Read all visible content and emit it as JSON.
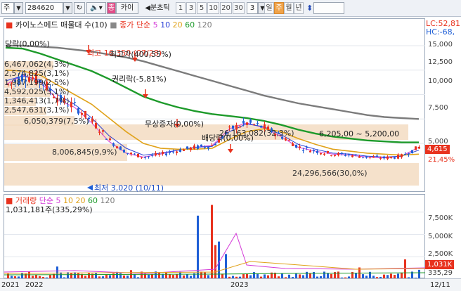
{
  "toolbar": {
    "market": "주",
    "code": "284620",
    "corner_btn": "↻",
    "kind": "종",
    "name": "카이",
    "period_prefix": "◀분초틱",
    "periods": [
      "1",
      "3",
      "5",
      "10",
      "20",
      "30"
    ],
    "count": "3",
    "day": "일",
    "week": "주",
    "month": "월",
    "year": "년"
  },
  "legend": {
    "title": "카이노스메드 매물대 수(10)",
    "ma_label": "종가 단순",
    "ma": [
      "5",
      "10",
      "20",
      "60",
      "120"
    ]
  },
  "volume_legend": {
    "title": "거래량",
    "ma_label": "단순",
    "ma": [
      "5",
      "10",
      "20",
      "60",
      "120"
    ],
    "summary": "1,031,181주(335,29%)"
  },
  "annotations": {
    "top_left": "당락(0,00%)",
    "high": "최고 16,350 (07/28)",
    "high_rate": "최고가(400,55%)",
    "right_issue": "권리락(-5,81%)",
    "split": "무상증자(0,00%)",
    "dividend": "배당락(0,00%)",
    "low": "최저 3,020 (10/11)",
    "range": "6,205,00 ~ 5,200,00"
  },
  "volume_profile": [
    "6,467,062(4,3%)",
    "2,574,825(3,1%)",
    "1,987,199(2,5%)",
    "4,592,025(5,1%)",
    "1,346,413(1,7%)",
    "2,547,631(3,1%)",
    "6,050,379(7,5%)",
    "8,006,845(9,9%)",
    "26,163,082(32,3%)",
    "24,296,566(30,0%)"
  ],
  "right_axis": {
    "lc": "LC:52,81",
    "hc": "HC:-68,",
    "price_ticks": [
      "15,000",
      "12,500",
      "10,000",
      "7,500",
      "5,000"
    ],
    "current_price": "4,615",
    "current_rate": "21,45%",
    "volume_ticks": [
      "7,500K",
      "5,000K",
      "2,500K"
    ],
    "current_volume": "1,031K",
    "current_volume_rate": "335,29"
  },
  "dates": {
    "left_cut": "2021",
    "y2022": "2022",
    "y2023": "2023",
    "right": "12/11"
  },
  "colors": {
    "up": "#e8321e",
    "down": "#1f5fd6",
    "ma5": "#d43bd8",
    "ma10": "#2a3fd6",
    "ma20": "#e0a21a",
    "ma60": "#1d9a2a",
    "ma120": "#7b7b7b",
    "profile": "#f3dcc2"
  },
  "chart_data": {
    "type": "candlestick",
    "ylim": [
      3000,
      16350
    ],
    "x_labels": [
      "2021",
      "2022",
      "2023",
      "12/11"
    ],
    "series": [
      {
        "name": "종가 단순 5",
        "values": [
          11000,
          12000,
          11300,
          9500,
          8700,
          7100,
          5200,
          4000,
          3600,
          3900,
          4300,
          4600,
          4800,
          6500,
          7100,
          6600,
          5700,
          4600,
          4200,
          3900,
          3800,
          3600,
          3500,
          3700,
          4615
        ]
      },
      {
        "name": "종가 단순 10",
        "values": [
          11400,
          11900,
          11500,
          10000,
          9000,
          7600,
          5800,
          4500,
          3800,
          4000,
          4300,
          4600,
          4700,
          6200,
          7000,
          6700,
          5900,
          4900,
          4400,
          4000,
          3900,
          3700,
          3600,
          3700,
          4300
        ]
      },
      {
        "name": "종가 단순 20",
        "values": [
          12500,
          12400,
          12000,
          11000,
          10000,
          9000,
          7600,
          6200,
          5000,
          4500,
          4400,
          4400,
          4500,
          5400,
          6200,
          6500,
          6200,
          5500,
          4900,
          4400,
          4200,
          4000,
          3900,
          3800,
          3900
        ]
      },
      {
        "name": "종가 단순 60",
        "values": [
          14800,
          14700,
          14200,
          13600,
          13000,
          12400,
          11600,
          10700,
          9800,
          9200,
          8700,
          8300,
          8000,
          7800,
          7600,
          7300,
          6900,
          6400,
          6000,
          5700,
          5500,
          5300,
          5200,
          5100,
          5100
        ]
      },
      {
        "name": "종가 단순 120",
        "values": [
          15000,
          15000,
          14900,
          14800,
          14600,
          14400,
          14100,
          13800,
          13400,
          12900,
          12400,
          11900,
          11400,
          10900,
          10400,
          9900,
          9500,
          9100,
          8800,
          8500,
          8200,
          7900,
          7700,
          7600,
          7500
        ]
      }
    ],
    "ohlc_sample": {
      "high": 16350,
      "low": 3020,
      "last": 4615,
      "change_pct": 21.45
    }
  }
}
